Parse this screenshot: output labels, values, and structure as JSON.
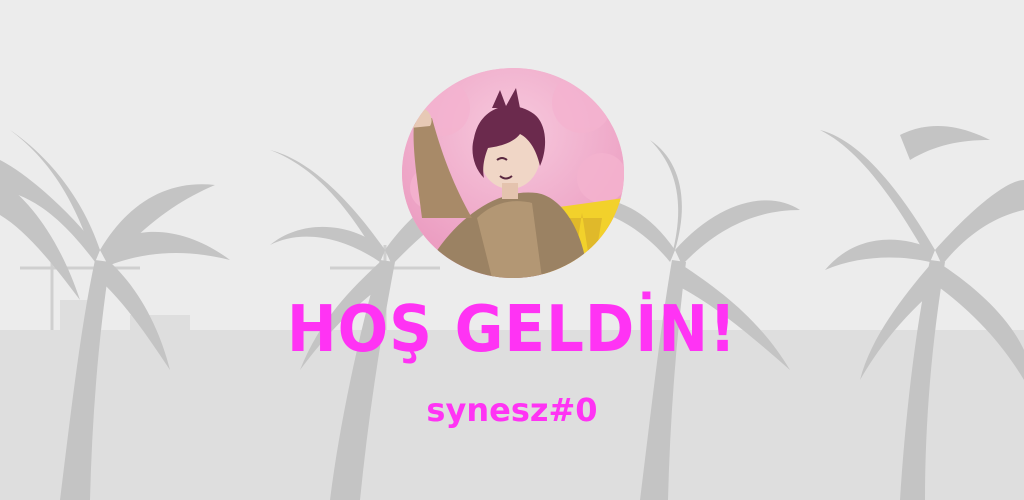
{
  "welcome_card": {
    "title": "HOŞ GELDİN!",
    "username": "synesz#0",
    "accent_color": "#ff33f4"
  },
  "background": {
    "description_icon": "palm-trees-city-icon"
  },
  "avatar": {
    "icon": "anime-avatar-icon"
  }
}
